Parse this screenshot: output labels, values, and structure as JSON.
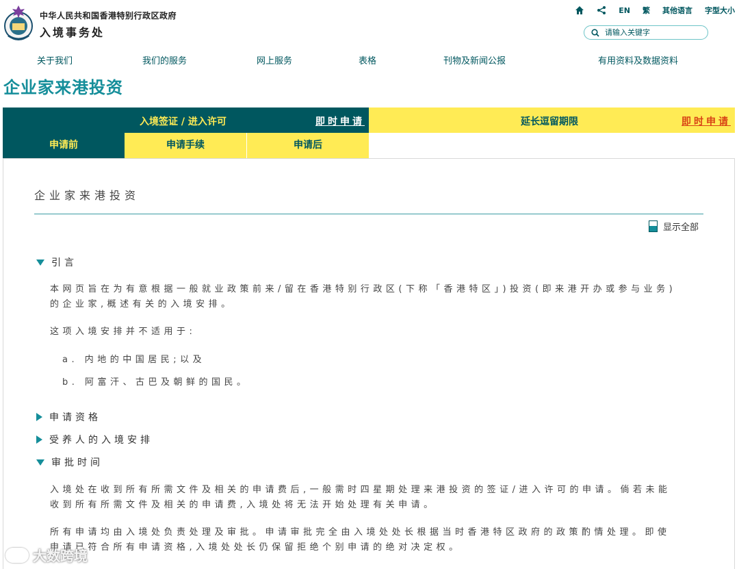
{
  "header": {
    "gov_name": "中华人民共和国香港特别行政区政府",
    "dept_name": "入境事务处",
    "links": {
      "en": "EN",
      "trad": "繁",
      "other_lang": "其他语言",
      "font_size": "字型大小"
    },
    "search_placeholder": "请输入关键字"
  },
  "nav": [
    "关于我们",
    "我们的服务",
    "网上服务",
    "表格",
    "刊物及新闻公报",
    "有用资料及数据资料"
  ],
  "page_title": "企业家来港投资",
  "tabs": {
    "visa": {
      "label": "入境签证 / 进入许可",
      "apply": "即时申请"
    },
    "extension": {
      "label": "延长逗留期限",
      "apply": "即时申请"
    },
    "sub": [
      "申请前",
      "申请手续",
      "申请后"
    ]
  },
  "content": {
    "title": "企业家来港投资",
    "show_all": "显示全部",
    "intro_heading": "引言",
    "intro_p1": "本网页旨在为有意根据一般就业政策前来/留在香港特别行政区(下称「香港特区」)投资(即来港开办或参与业务)的企业家,概述有关的入境安排。",
    "intro_p2": "这项入境安排并不适用于:",
    "intro_items": [
      "a. 内地的中国居民;以及",
      "b. 阿富汗、古巴及朝鲜的国民。"
    ],
    "sections": [
      "申请资格",
      "受养人的入境安排",
      "审批时间"
    ],
    "approval_p1": "入境处在收到所有所需文件及相关的申请费后,一般需时四星期处理来港投资的签证/进入许可的申请。倘若未能收到所有所需文件及相关的申请费,入境处将无法开始处理有关申请。",
    "approval_p2": "所有申请均由入境处负责处理及审批。申请审批完全由入境处处长根据当时香港特区政府的政策酌情处理。即使申请已符合所有申请资格,入境处处长仍保留拒绝个别申请的绝对决定权。"
  },
  "watermark": "大数跨境",
  "colors": {
    "teal_dark": "#00575f",
    "teal": "#158e9a",
    "yellow": "#ffeb55",
    "orange": "#d84315"
  }
}
